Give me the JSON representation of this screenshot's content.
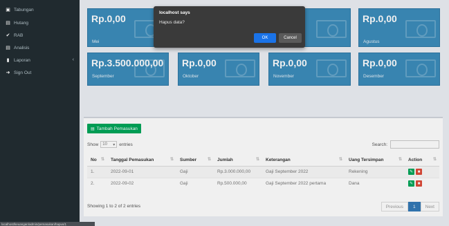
{
  "sidebar": {
    "items": [
      {
        "label": "Tabungan",
        "icon": "bank-icon"
      },
      {
        "label": "Hutang",
        "icon": "money-icon"
      },
      {
        "label": "RAB",
        "icon": "check-icon"
      },
      {
        "label": "Analisis",
        "icon": "chart-icon"
      },
      {
        "label": "Laporan",
        "icon": "book-icon"
      },
      {
        "label": "Sign Out",
        "icon": "sign-out-icon"
      }
    ]
  },
  "cards": [
    {
      "amount": "Rp.0,00",
      "month": "Mei"
    },
    {
      "amount": "0",
      "month": ""
    },
    {
      "amount": "Rp.0,00",
      "month": "Agustus"
    },
    {
      "amount": "Rp.3.500.000,00",
      "month": "September"
    },
    {
      "amount": "Rp.0,00",
      "month": "Oktober"
    },
    {
      "amount": "Rp.0,00",
      "month": "November"
    },
    {
      "amount": "Rp.0,00",
      "month": "Desember"
    }
  ],
  "dialog": {
    "title": "localhost says",
    "message": "Hapus data?",
    "ok": "OK",
    "cancel": "Cancel"
  },
  "panel": {
    "add_button": "Tambah Pemasukan",
    "show_label": "Show",
    "show_value": "10",
    "entries_label": "entries",
    "search_label": "Search:",
    "columns": [
      "No",
      "Tanggal Pemasukan",
      "Sumber",
      "Jumlah",
      "Keterangan",
      "Uang Tersimpan",
      "Action"
    ],
    "rows": [
      {
        "no": "1.",
        "tanggal": "2022-09-01",
        "sumber": "Gaji",
        "jumlah": "Rp.3.000.000,00",
        "keterangan": "Gaji September 2022",
        "uang": "Rekening"
      },
      {
        "no": "2.",
        "tanggal": "2022-09-02",
        "sumber": "Gaji",
        "jumlah": "Rp.500.000,00",
        "keterangan": "Gaji September 2022 pertama",
        "uang": "Dana"
      }
    ],
    "info": "Showing 1 to 2 of 2 entries",
    "pager": {
      "previous": "Previous",
      "current": "1",
      "next": "Next"
    }
  },
  "statusbar": "localhost/keuangan/admin/pemasukan/hapus/1"
}
